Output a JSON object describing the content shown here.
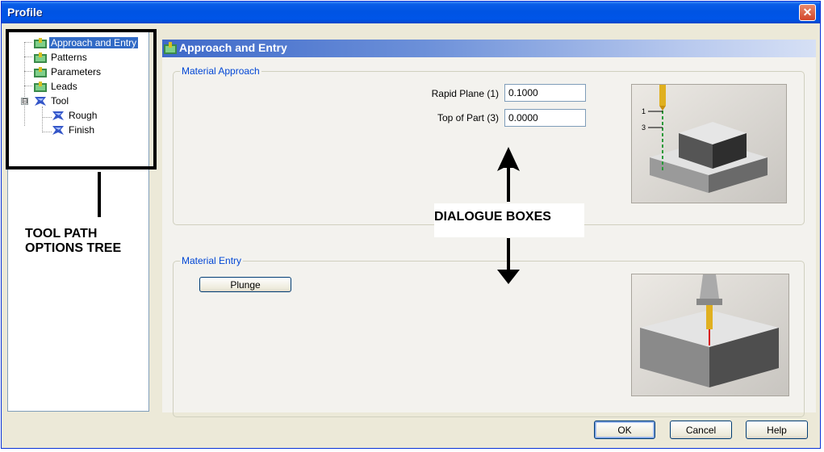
{
  "window": {
    "title": "Profile",
    "close_glyph": "✕"
  },
  "tree": {
    "items": [
      {
        "label": "Approach and Entry",
        "icon": "approach-entry-icon",
        "selected": true
      },
      {
        "label": "Patterns",
        "icon": "patterns-icon"
      },
      {
        "label": "Parameters",
        "icon": "parameters-icon"
      },
      {
        "label": "Leads",
        "icon": "leads-icon"
      },
      {
        "label": "Tool",
        "icon": "tool-icon",
        "expander": "⊟"
      },
      {
        "label": "Rough",
        "icon": "rough-tool-icon"
      },
      {
        "label": "Finish",
        "icon": "finish-tool-icon"
      }
    ]
  },
  "annotations": {
    "tree_label": "TOOL PATH OPTIONS TREE",
    "dialogue_label": "DIALOGUE BOXES"
  },
  "panel": {
    "title": "Approach and Entry",
    "material_approach": {
      "label": "Material Approach",
      "rapid_plane_label": "Rapid Plane (1)",
      "rapid_plane_value": "0.1000",
      "top_of_part_label": "Top of Part (3)",
      "top_of_part_value": "0.0000",
      "preview_marker_1": "1",
      "preview_marker_3": "3"
    },
    "material_entry": {
      "label": "Material Entry",
      "plunge_label": "Plunge"
    }
  },
  "buttons": {
    "ok": "OK",
    "cancel": "Cancel",
    "help": "Help"
  },
  "colors": {
    "accent": "#0054e3",
    "group_label": "#0046d5",
    "selection": "#316ac5"
  }
}
